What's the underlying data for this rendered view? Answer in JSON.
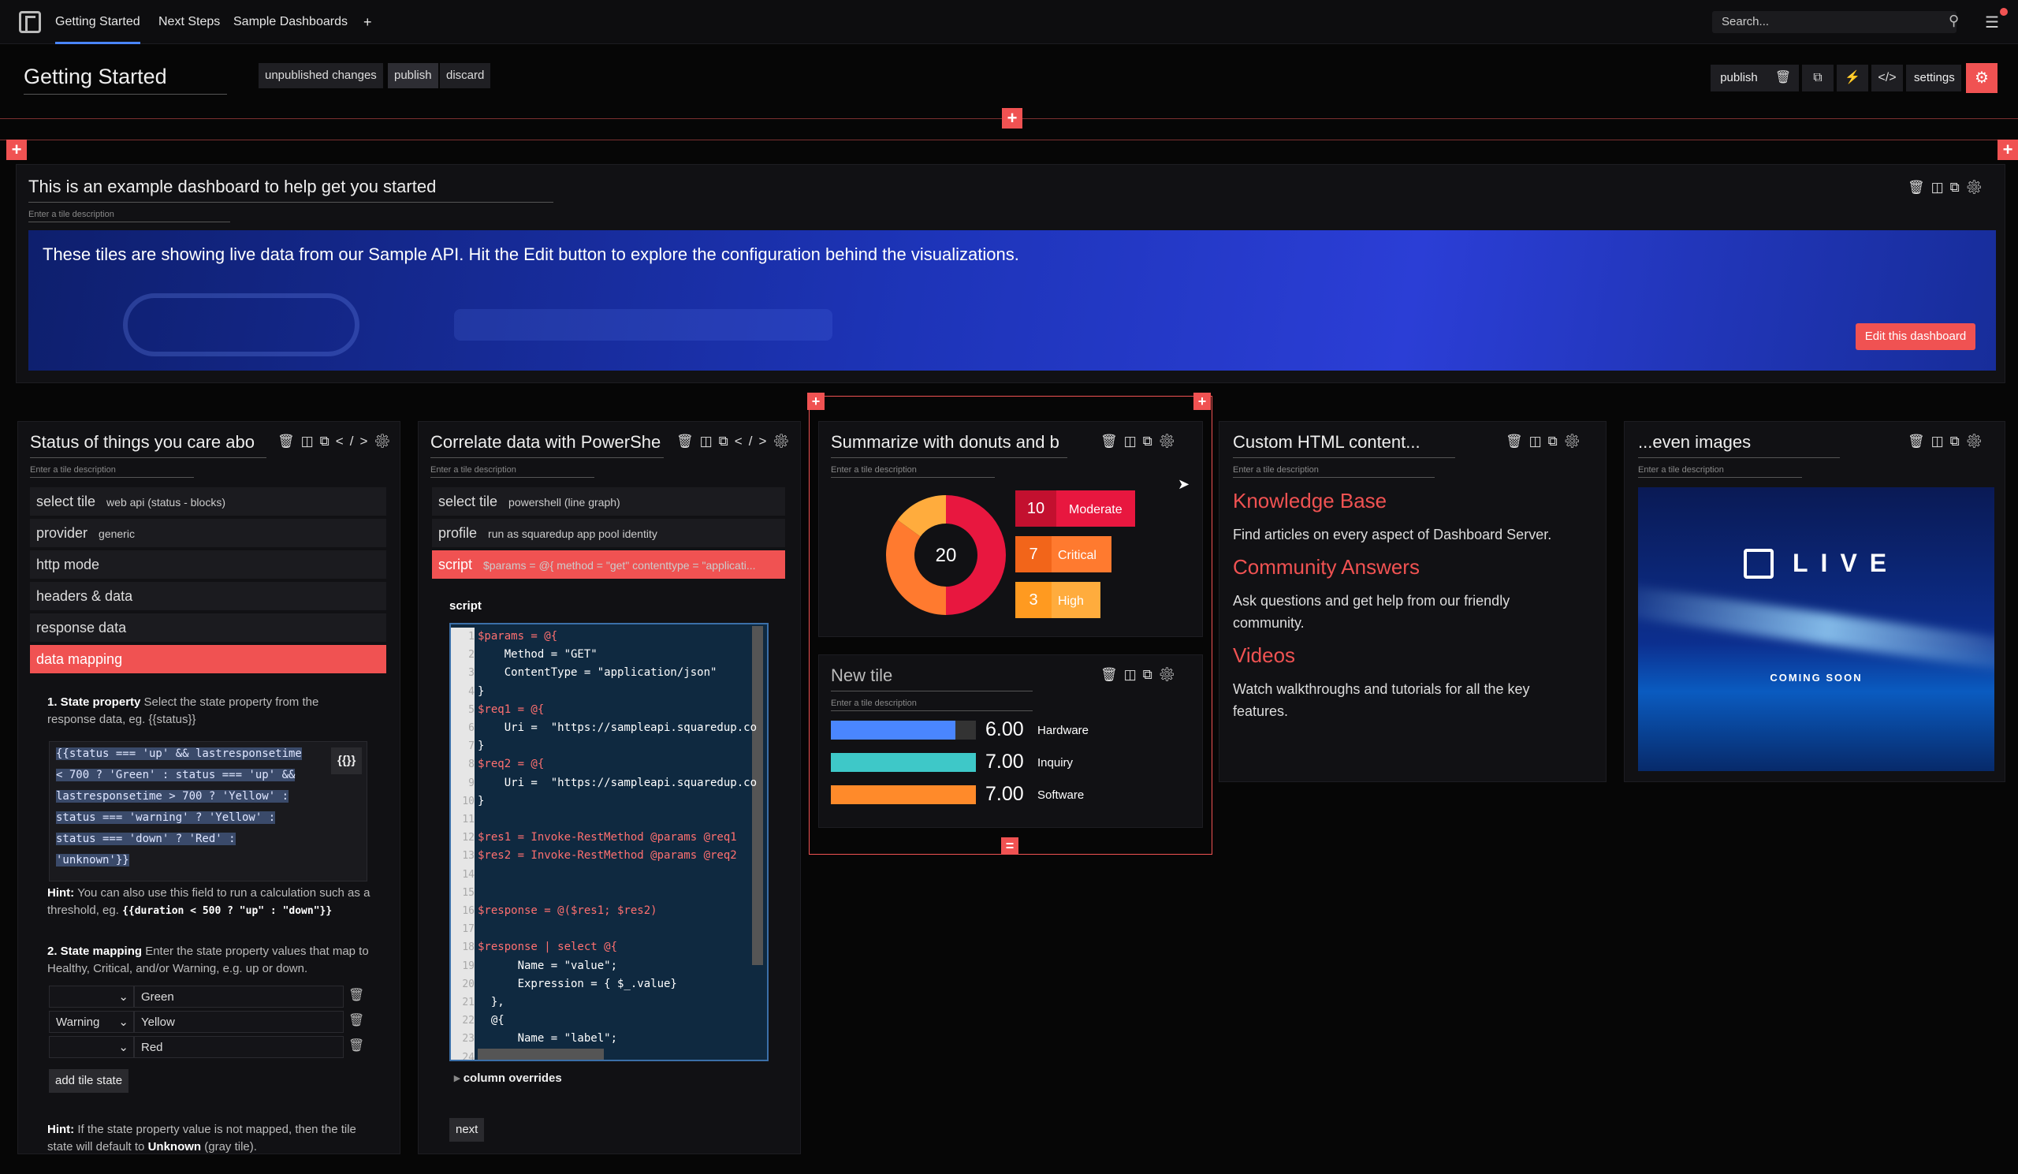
{
  "nav": {
    "tabs": [
      "Getting Started",
      "Next Steps",
      "Sample Dashboards"
    ],
    "add": "+",
    "search_placeholder": "Search...",
    "notif_count": "1"
  },
  "header": {
    "title": "Getting Started",
    "unpublished": "unpublished changes",
    "publish": "publish",
    "discard": "discard",
    "right_publish": "publish",
    "settings": "settings"
  },
  "intro": {
    "title": "This is an example dashboard to help get you started",
    "desc": "Enter a tile description",
    "banner": "These tiles are showing live data from our Sample API. Hit the Edit button to explore the configuration behind the visualizations.",
    "edit": "Edit this dashboard"
  },
  "tile1": {
    "title": "Status of things you care abo",
    "desc": "Enter a tile description",
    "items": [
      {
        "label": "select tile",
        "sub": "web api (status - blocks)"
      },
      {
        "label": "provider",
        "sub": "generic"
      },
      {
        "label": "http mode",
        "sub": ""
      },
      {
        "label": "headers & data",
        "sub": ""
      },
      {
        "label": "response data",
        "sub": ""
      },
      {
        "label": "data mapping",
        "sub": ""
      }
    ],
    "state_title": "1. State property",
    "state_text": "Select the state property from the response data, eg. {{status}}",
    "code": [
      "{{status === 'up' && lastresponsetime",
      "< 700 ? 'Green' : status === 'up' &&",
      "lastresponsetime > 700 ? 'Yellow' :",
      "status === 'warning' ? 'Yellow' :",
      "status === 'down' ? 'Red' :",
      "'unknown'}}"
    ],
    "braces": "{{}}",
    "hint1_b": "Hint:",
    "hint1": "You can also use this field to run a calculation such as a threshold, eg.",
    "hint1_code": "{{duration < 500 ? \"up\" : \"down\"}}",
    "map_title": "2. State mapping",
    "map_text": "Enter the state property values that map to Healthy, Critical, and/or Warning, e.g. up or down.",
    "rows": [
      {
        "sel": "",
        "val": "Green"
      },
      {
        "sel": "Warning",
        "val": "Yellow"
      },
      {
        "sel": "",
        "val": "Red"
      }
    ],
    "add": "add tile state",
    "hint2_b": "Hint:",
    "hint2": "If the state property value is not mapped, then the tile state will default to",
    "hint2_unknown": "Unknown",
    "hint2_end": "(gray tile)."
  },
  "tile2": {
    "title": "Correlate data with PowerShe",
    "desc": "Enter a tile description",
    "items": [
      {
        "label": "select tile",
        "sub": "powershell (line graph)"
      },
      {
        "label": "profile",
        "sub": "run as squaredup app pool identity"
      },
      {
        "label": "script",
        "sub": "$params = @{ method = \"get\" contenttype = \"applicati..."
      }
    ],
    "script_label": "script",
    "lines": [
      "$params = @{",
      "    Method = \"GET\"",
      "    ContentType = \"application/json\"",
      "}",
      "$req1 = @{",
      "    Uri =  \"https://sampleapi.squaredup.co",
      "}",
      "$req2 = @{",
      "    Uri =  \"https://sampleapi.squaredup.co",
      "}",
      "",
      "$res1 = Invoke-RestMethod @params @req1",
      "$res2 = Invoke-RestMethod @params @req2",
      "",
      "",
      "$response = @($res1; $res2)",
      "",
      "$response | select @{",
      "      Name = \"value\";",
      "      Expression = { $_.value}",
      "  },",
      "  @{",
      "      Name = \"label\";",
      ""
    ],
    "overrides": "column overrides",
    "next": "next"
  },
  "tile3": {
    "title": "Summarize with donuts and b",
    "desc": "Enter a tile description",
    "center": "20",
    "legend": [
      {
        "num": "10",
        "label": "Moderate"
      },
      {
        "num": "7",
        "label": "Critical"
      },
      {
        "num": "3",
        "label": "High"
      }
    ],
    "colors": {
      "moderate": "#e8173f",
      "critical": "#ff7a2f",
      "high": "#ffac3d"
    }
  },
  "tile4": {
    "title": "New tile",
    "desc": "Enter a tile description",
    "bars": [
      {
        "value": "6.00",
        "label": "Hardware",
        "frac": 0.86,
        "color": "#4a86ff"
      },
      {
        "value": "7.00",
        "label": "Inquiry",
        "frac": 1.0,
        "color": "#3ec8c8"
      },
      {
        "value": "7.00",
        "label": "Software",
        "frac": 1.0,
        "color": "#ff8a2a"
      }
    ]
  },
  "tile5": {
    "title": "Custom HTML content...",
    "desc": "Enter a tile description",
    "links": [
      {
        "title": "Knowledge Base",
        "text": "Find articles on every aspect of Dashboard Server."
      },
      {
        "title": "Community Answers",
        "text": "Ask questions and get help from our friendly community."
      },
      {
        "title": "Videos",
        "text": "Watch walkthroughs and tutorials for all the key features."
      }
    ]
  },
  "tile6": {
    "title": "...even images",
    "desc": "Enter a tile description",
    "live": "LIVE",
    "coming": "COMING SOON"
  }
}
